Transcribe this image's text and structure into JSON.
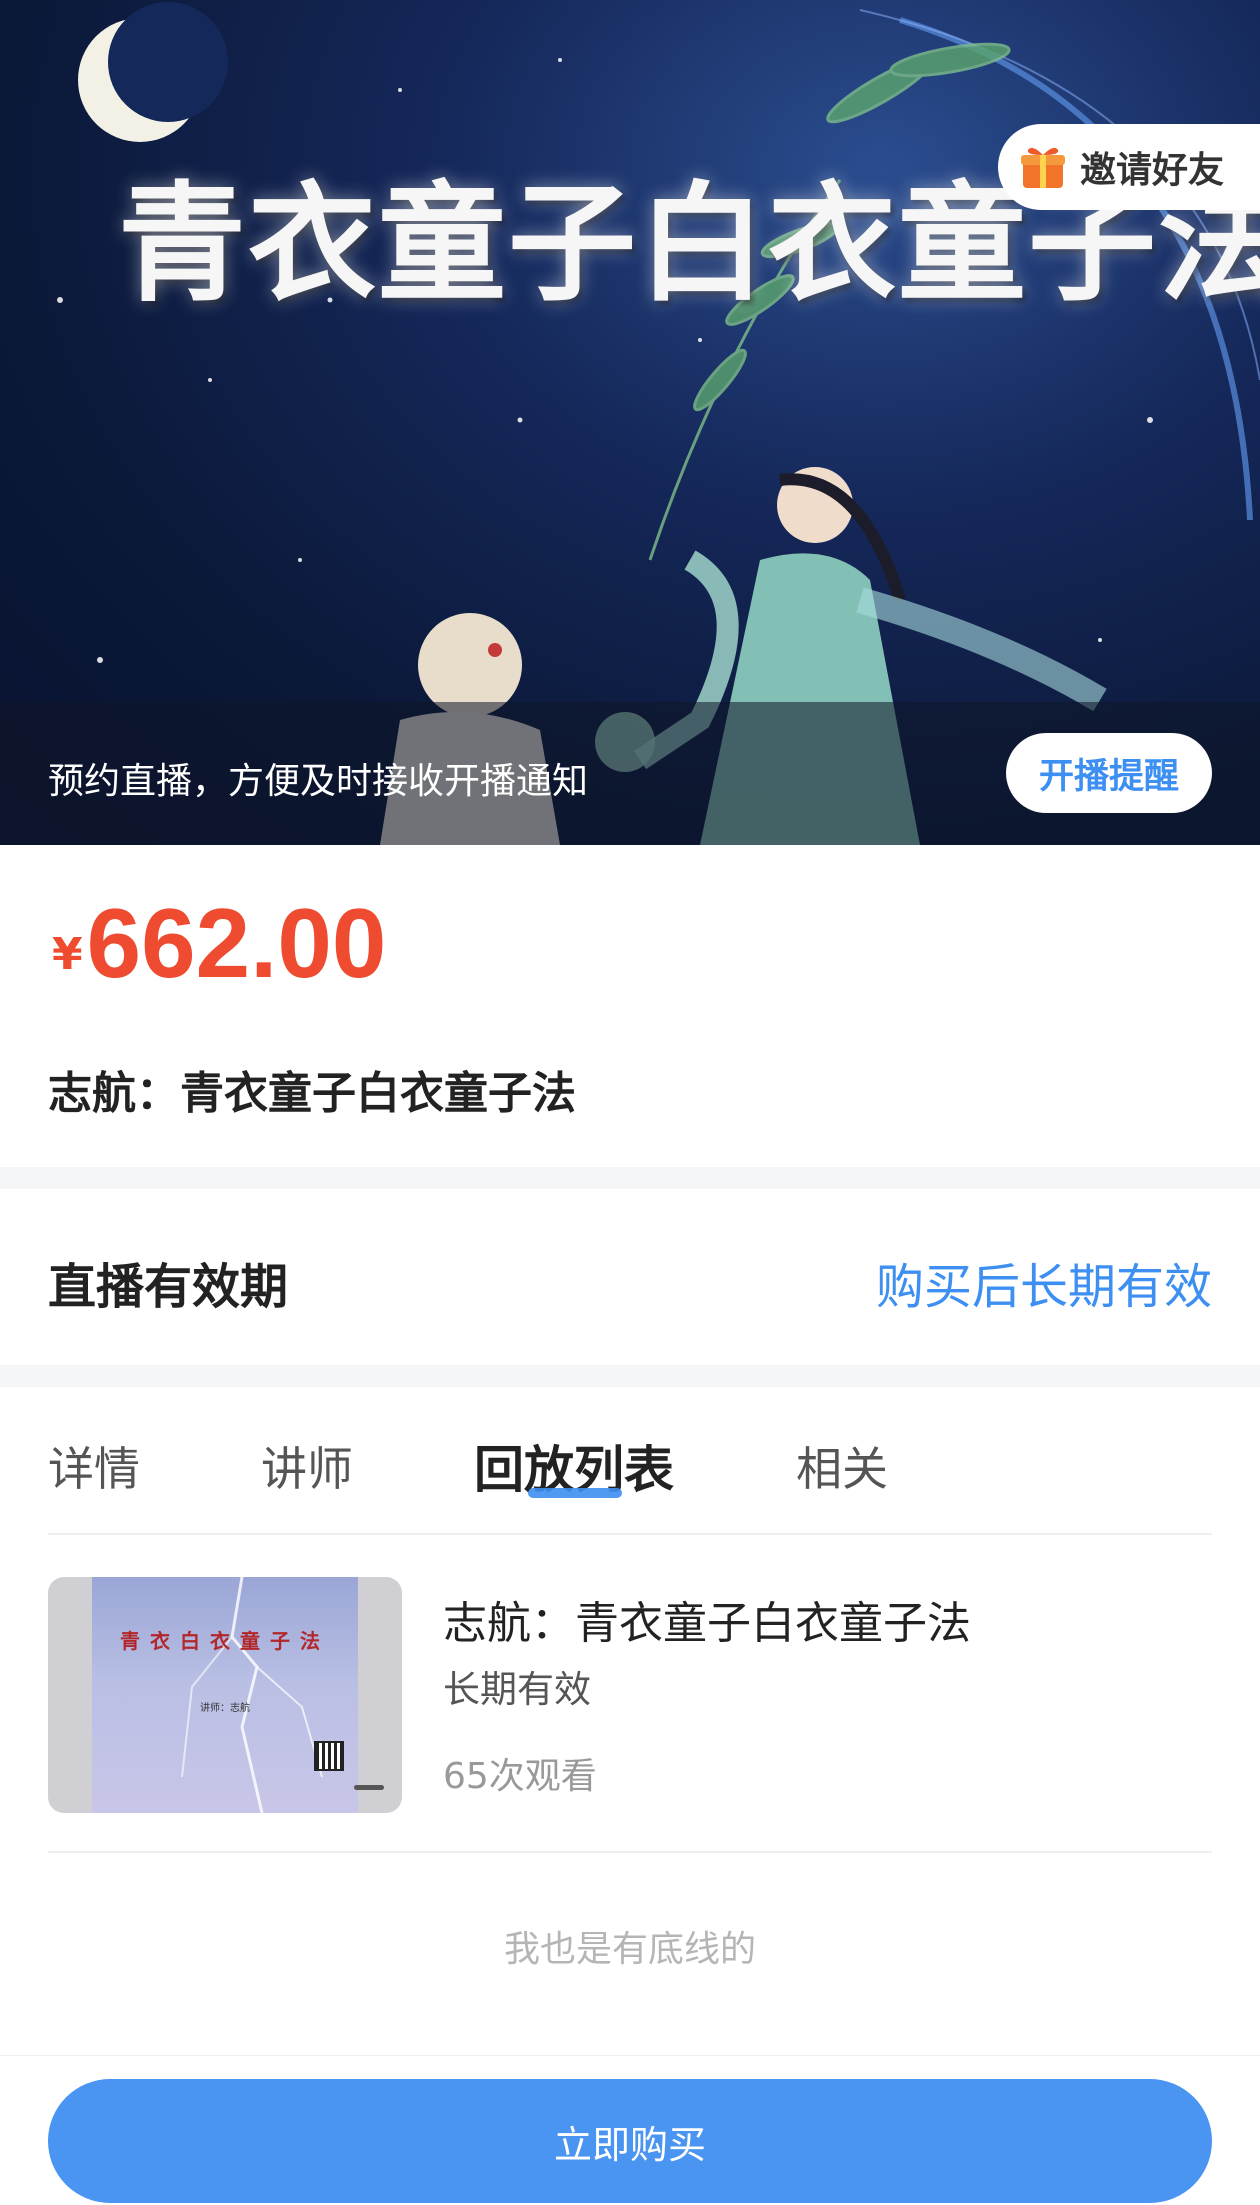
{
  "banner": {
    "title": "青衣童子白衣童子法",
    "invite_label": "邀请好友",
    "reminder_text": "预约直播，方便及时接收开播通知",
    "reminder_button": "开播提醒"
  },
  "product": {
    "currency_symbol": "¥",
    "price": "662.00",
    "title": "志航：青衣童子白衣童子法"
  },
  "validity": {
    "label": "直播有效期",
    "value": "购买后长期有效"
  },
  "tabs": [
    {
      "label": "详情"
    },
    {
      "label": "讲师"
    },
    {
      "label": "回放列表"
    },
    {
      "label": "相关"
    }
  ],
  "active_tab": "回放列表",
  "replays": [
    {
      "title": "志航：青衣童子白衣童子法",
      "validity": "长期有效",
      "views": "65次观看",
      "thumbnail": {
        "title": "青衣白衣童子法",
        "teacher": "讲师：志航"
      }
    }
  ],
  "end_of_list": "我也是有底线的",
  "footer": {
    "buy_label": "立即购买"
  },
  "colors": {
    "price": "#ef4b30",
    "accent": "#3d8ff2",
    "buy_button": "#4a94f2"
  }
}
